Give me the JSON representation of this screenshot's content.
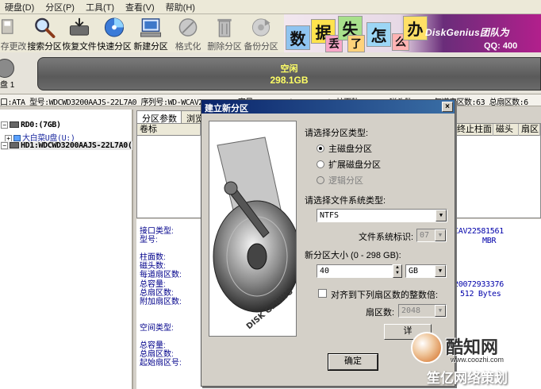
{
  "menu": [
    "硬盘(D)",
    "分区(P)",
    "工具(T)",
    "查看(V)",
    "帮助(H)"
  ],
  "toolbar": [
    {
      "label": "存更改",
      "icon": "save-icon",
      "disabled": true
    },
    {
      "label": "搜索分区",
      "icon": "magnifier-icon",
      "disabled": false
    },
    {
      "label": "恢复文件",
      "icon": "recover-icon",
      "disabled": false
    },
    {
      "label": "快速分区",
      "icon": "quick-partition-icon",
      "disabled": false
    },
    {
      "label": "新建分区",
      "icon": "new-partition-icon",
      "disabled": false
    },
    {
      "label": "格式化",
      "icon": "format-icon",
      "disabled": true
    },
    {
      "label": "删除分区",
      "icon": "delete-icon",
      "disabled": true
    },
    {
      "label": "备份分区",
      "icon": "backup-icon",
      "disabled": true
    }
  ],
  "banner": {
    "tiles": [
      "数",
      "据",
      "丢",
      "失",
      "了",
      "怎",
      "么",
      "办"
    ],
    "brand": "DiskGenius团队为",
    "qq": "QQ: 400"
  },
  "disk": {
    "label_prefix": "盘 1",
    "partition_label": "空闲",
    "partition_size": "298.1GB"
  },
  "info_line": "口:ATA  型号:WDCWD3200AAJS-22L7A0  序列号:WD-WCAV22581561  容量:298.1GB(305245MB)  柱面数:38913  磁头数:255  每道扇区数:63  总扇区数:6",
  "tree": {
    "items": [
      "RD0:(7GB)",
      "大白菜U盘(U:)",
      "HD1:WDCWD3200AAJS-22L7A0("
    ]
  },
  "tabs": [
    "分区参数",
    "浏览"
  ],
  "grid_headers": [
    "卷标",
    "终止柱面",
    "磁头",
    "扇区"
  ],
  "props": {
    "labels": [
      "接口类型:",
      "型号:",
      "柱面数:",
      "磁头数:",
      "每道扇区数:",
      "总容量:",
      "总扇区数:",
      "附加扇区数:",
      "空间类型:",
      "总容量:",
      "总扇区数:",
      "起始扇区号:"
    ],
    "values": [
      "CAV22581561",
      "MBR",
      "20072933376",
      "512 Bytes"
    ]
  },
  "dialog": {
    "title": "建立新分区",
    "close": "×",
    "partition_type_label": "请选择分区类型:",
    "options": [
      {
        "label": "主磁盘分区",
        "checked": true,
        "disabled": false
      },
      {
        "label": "扩展磁盘分区",
        "checked": false,
        "disabled": false
      },
      {
        "label": "逻辑分区",
        "checked": false,
        "disabled": true
      }
    ],
    "fs_label": "请选择文件系统类型:",
    "fs_value": "NTFS",
    "fs_id_label": "文件系统标识:",
    "fs_id_value": "07",
    "size_label": "新分区大小 (0 - 298 GB):",
    "size_value": "40",
    "size_unit": "GB",
    "align_label": "对齐到下列扇区数的整数倍:",
    "sector_label": "扇区数:",
    "sector_value": "2048",
    "detail_button": "详",
    "ok_button": "确定",
    "image_text": "DISK GENIUS"
  },
  "watermark": {
    "name": "酷知网",
    "url": "www.coozhi.com",
    "slogan": "笙亿网络策划"
  }
}
